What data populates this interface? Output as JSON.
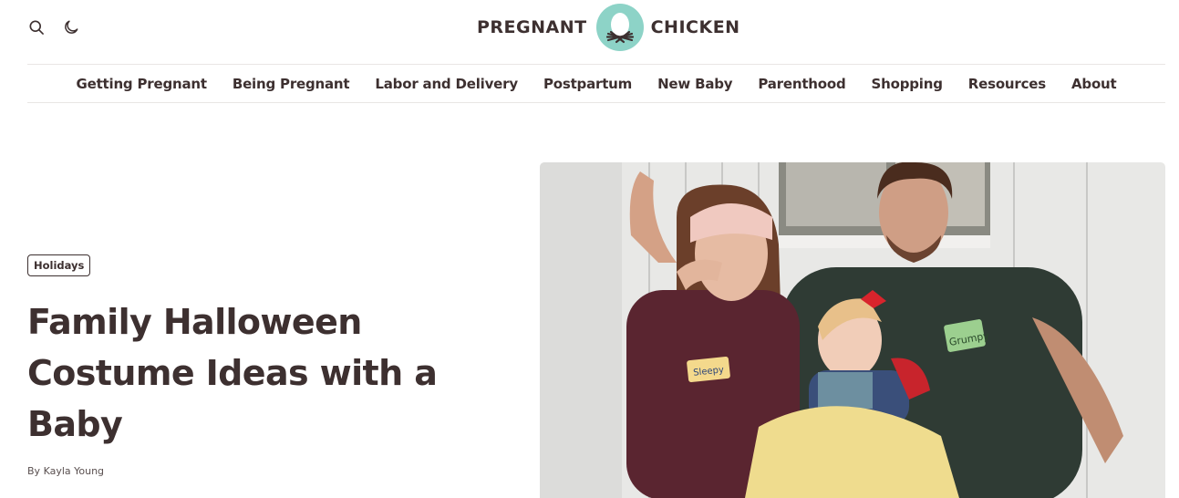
{
  "header": {
    "logo_left": "PREGNANT",
    "logo_right": "CHICKEN",
    "search_icon": "search-icon",
    "theme_icon": "moon-icon",
    "brand_color": "#8dd3c7"
  },
  "nav": {
    "items": [
      {
        "label": "Getting Pregnant"
      },
      {
        "label": "Being Pregnant"
      },
      {
        "label": "Labor and Delivery"
      },
      {
        "label": "Postpartum"
      },
      {
        "label": "New Baby"
      },
      {
        "label": "Parenthood"
      },
      {
        "label": "Shopping"
      },
      {
        "label": "Resources"
      },
      {
        "label": "About"
      }
    ]
  },
  "article": {
    "category": "Holidays",
    "title": "Family Halloween Costume Ideas with a Baby",
    "byline_prefix": "By",
    "author": "Kayla Young"
  },
  "hero": {
    "tag_sleepy": "Sleepy",
    "tag_grumpy": "Grumpy"
  },
  "colors": {
    "text": "#3d3030",
    "divider": "#e9e6e4"
  }
}
